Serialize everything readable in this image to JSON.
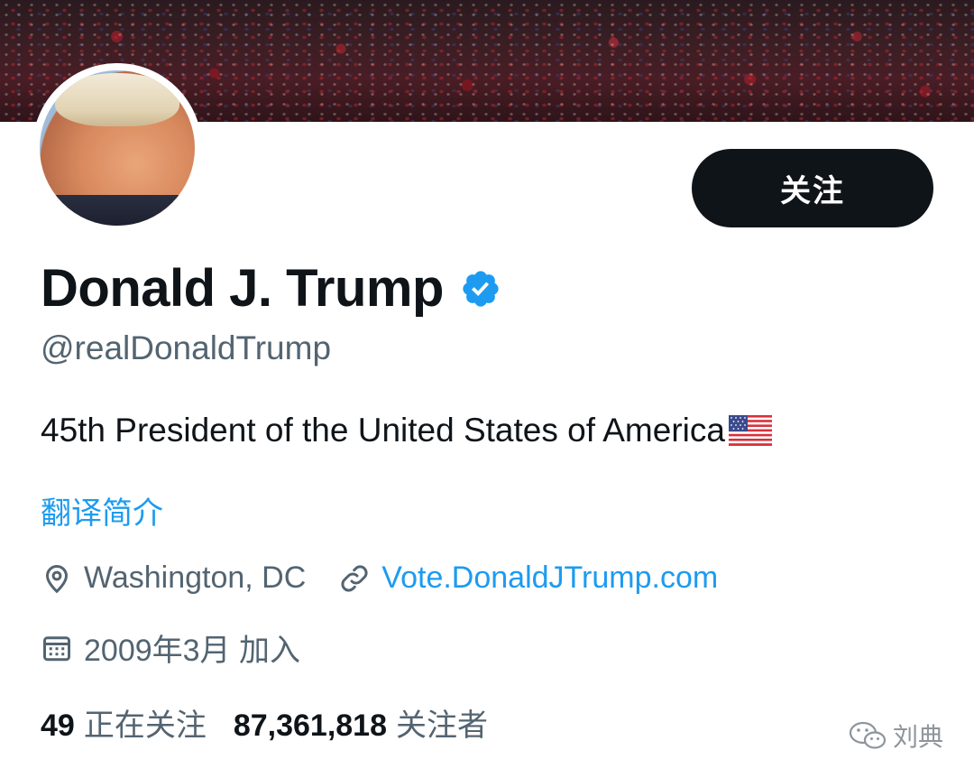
{
  "profile": {
    "display_name": "Donald J. Trump",
    "handle": "@realDonaldTrump",
    "bio": "45th President of the United States of America",
    "bio_emoji": "us-flag",
    "translate_label": "翻译简介",
    "location": "Washington, DC",
    "website": "Vote.DonaldJTrump.com",
    "joined": "2009年3月 加入",
    "verified": true
  },
  "actions": {
    "follow_label": "关注"
  },
  "stats": {
    "following_count": "49",
    "following_label": "正在关注",
    "followers_count": "87,361,818",
    "followers_label": "关注者"
  },
  "watermark": {
    "text": "刘典"
  },
  "icons": {
    "verified": "verified-badge-icon",
    "location": "location-pin-icon",
    "link": "link-icon",
    "calendar": "calendar-icon",
    "wechat": "wechat-icon"
  },
  "colors": {
    "text_primary": "#0f1419",
    "text_secondary": "#536471",
    "accent": "#1d9bf0",
    "button_bg": "#0f1419",
    "button_text": "#ffffff"
  }
}
